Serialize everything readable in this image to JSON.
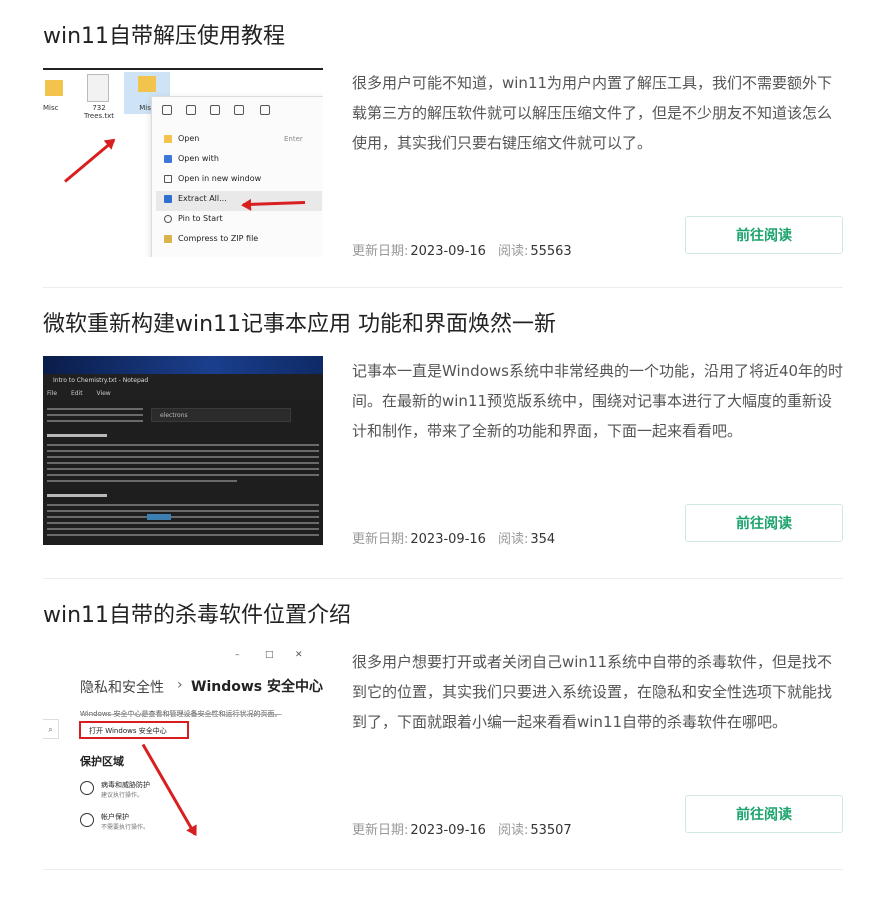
{
  "button_label": "前往阅读",
  "meta": {
    "date_label": "更新日期:",
    "read_label": "阅读:"
  },
  "articles": [
    {
      "title": "win11自带解压使用教程",
      "description": "很多用户可能不知道，win11为用户内置了解压工具，我们不需要额外下载第三方的解压软件就可以解压压缩文件了，但是不少朋友不知道该怎么使用，其实我们只要右键压缩文件就可以了。",
      "date": "2023-09-16",
      "reads": "55563",
      "thumb": {
        "files": [
          "Misc",
          "732 Trees.txt",
          "Misc"
        ],
        "menu_items": [
          "Open",
          "Open with",
          "Open in new window",
          "Extract All...",
          "Pin to Start",
          "Compress to ZIP file"
        ],
        "shortcut": "Enter"
      }
    },
    {
      "title": "微软重新构建win11记事本应用 功能和界面焕然一新",
      "description": "记事本一直是Windows系统中非常经典的一个功能，沿用了将近40年的时间。在最新的win11预览版系统中，围绕对记事本进行了大幅度的重新设计和制作，带来了全新的功能和界面，下面一起来看看吧。",
      "date": "2023-09-16",
      "reads": "354",
      "thumb": {
        "window_title": "Intro to Chemistry.txt - Notepad",
        "menu": "File Edit View",
        "search_text": "electrons",
        "headings": [
          "1. Carbon, the Element",
          "2. Chemistry Fundamentals"
        ]
      }
    },
    {
      "title": "win11自带的杀毒软件位置介绍",
      "description": "很多用户想要打开或者关闭自己win11系统中自带的杀毒软件，但是找不到它的位置，其实我们只要进入系统设置，在隐私和安全性选项下就能找到了，下面就跟着小编一起来看看win11自带的杀毒软件在哪吧。",
      "date": "2023-09-16",
      "reads": "53507",
      "thumb": {
        "crumb_parent": "隐私和安全性",
        "crumb_sep": "›",
        "crumb_current": "Windows 安全中心",
        "intro": "Windows 安全中心是查看和管理设备安全性和运行状况的页面。",
        "open_button": "打开 Windows 安全中心",
        "section": "保护区域",
        "items": [
          {
            "name": "病毒和威胁防护",
            "sub": "建议执行操作。"
          },
          {
            "name": "帐户保护",
            "sub": "不需要执行操作。"
          }
        ]
      }
    }
  ]
}
